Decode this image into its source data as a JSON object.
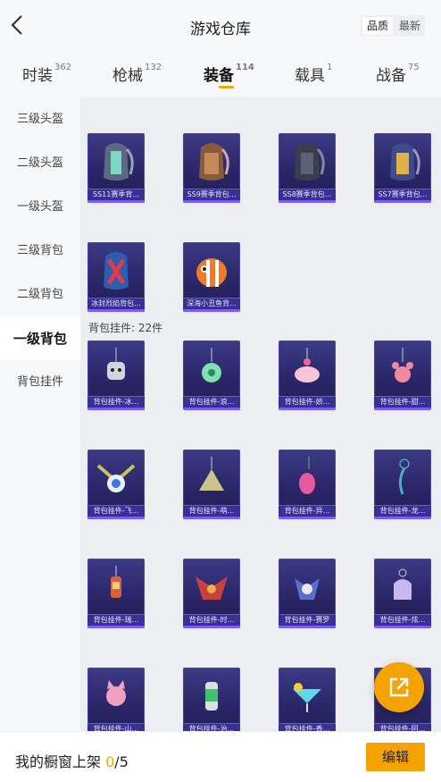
{
  "header": {
    "title": "游戏仓库",
    "sort_options": [
      "品质",
      "最新"
    ],
    "active_sort": "品质"
  },
  "tabs": [
    {
      "label": "时装",
      "count": "362"
    },
    {
      "label": "枪械",
      "count": "132"
    },
    {
      "label": "装备",
      "count": "114"
    },
    {
      "label": "载具",
      "count": "1"
    },
    {
      "label": "战备",
      "count": "75"
    }
  ],
  "sidebar": {
    "items": [
      "三级头盔",
      "二级头盔",
      "一级头盔",
      "三级背包",
      "二级背包",
      "一级背包",
      "背包挂件"
    ],
    "active": "一级背包"
  },
  "backpacks": [
    "SS11赛季背...",
    "SS9赛季背包...",
    "SS8赛季背包...",
    "SS7赛季背包...",
    "冰封烈焰背包...",
    "深海小丑鱼背..."
  ],
  "pendant_group": {
    "label": "背包挂件: 22件"
  },
  "pendants": [
    "背包挂件-冰...",
    "背包挂件-浪...",
    "背包挂件-娇...",
    "背包挂件-甜...",
    "背包挂件-飞...",
    "背包挂件-萌...",
    "背包挂件-异...",
    "背包挂件-龙...",
    "背包挂件-瑞...",
    "背包挂件-时...",
    "背包挂件-赛罗",
    "背包挂件-炫...",
    "背包挂件-山...",
    "背包挂件-治...",
    "背包挂件-香...",
    "背包挂件-阿..."
  ],
  "footer": {
    "label": "我的橱窗上架",
    "current": "0",
    "total": "/5",
    "edit_label": "编辑"
  },
  "colors": {
    "accent": "#f5a300",
    "card_bg": "#2a2668",
    "card_bar": "#3a2f93"
  }
}
